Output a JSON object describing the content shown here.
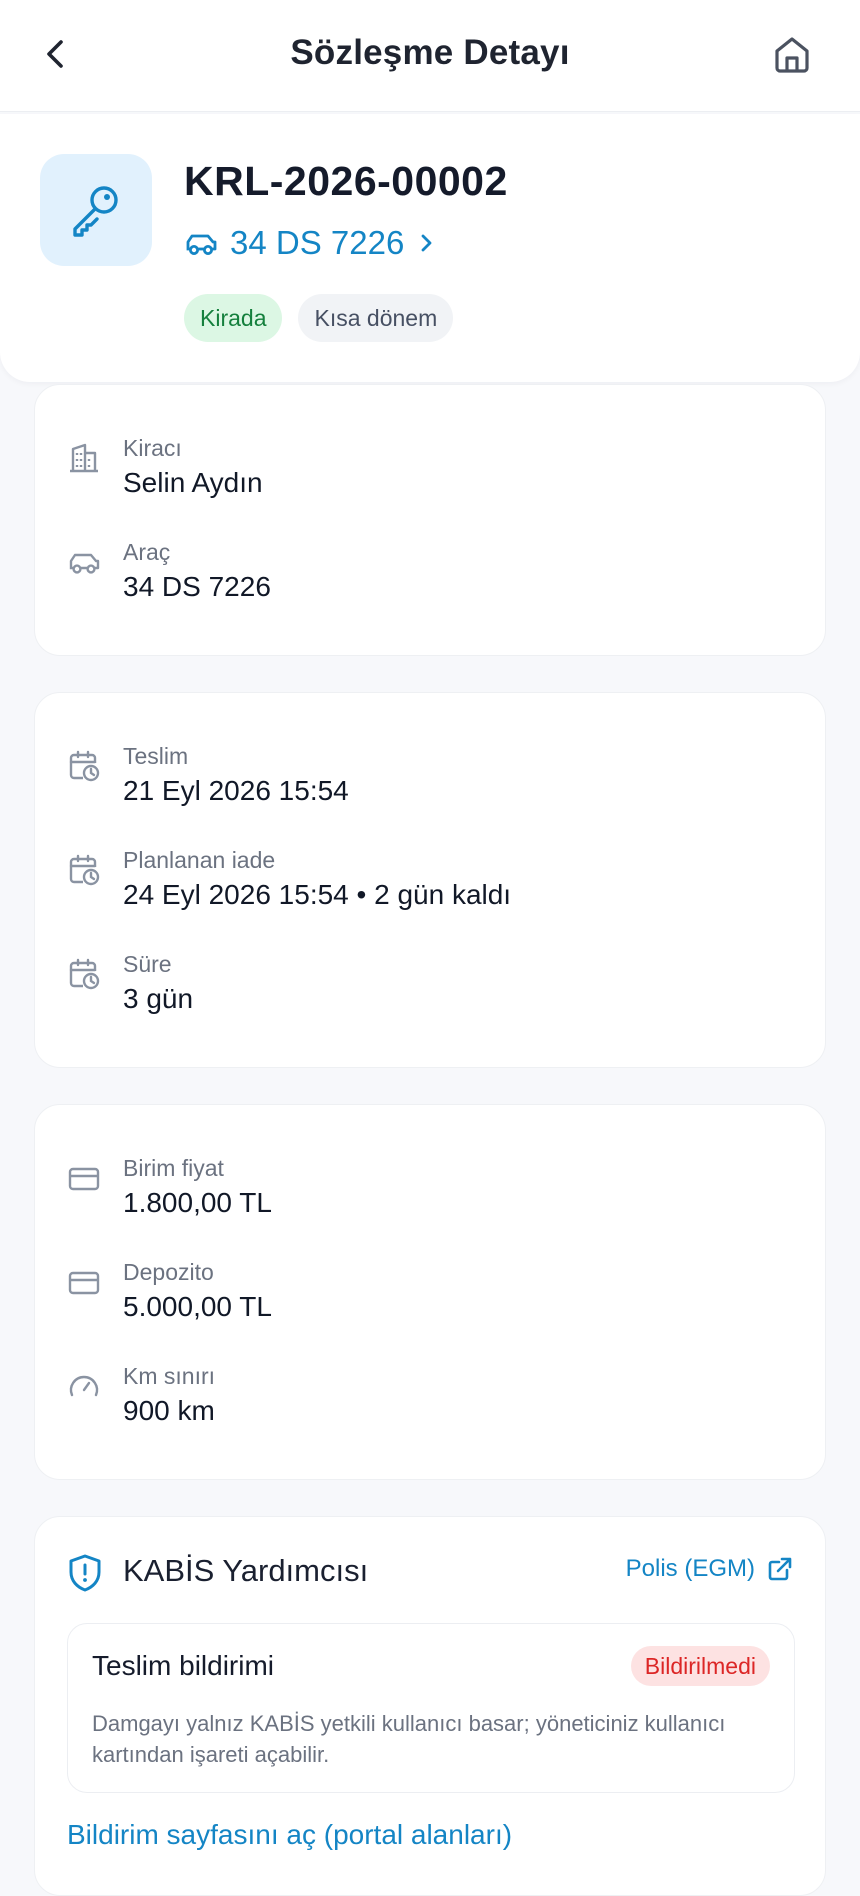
{
  "header": {
    "title": "Sözleşme Detayı"
  },
  "contract": {
    "number": "KRL-2026-00002",
    "plate": "34 DS 7226",
    "badges": [
      "Kirada",
      "Kısa dönem"
    ]
  },
  "party_card": {
    "rows": [
      {
        "label": "Kiracı",
        "value": "Selin Aydın",
        "icon": "building-icon"
      },
      {
        "label": "Araç",
        "value": "34 DS 7226",
        "icon": "car-icon"
      }
    ]
  },
  "dates_card": {
    "rows": [
      {
        "label": "Teslim",
        "value": "21 Eyl 2026 15:54",
        "icon": "calendar-clock-icon"
      },
      {
        "label": "Planlanan iade",
        "value": "24 Eyl 2026 15:54 • 2 gün kaldı",
        "icon": "calendar-clock-icon"
      },
      {
        "label": "Süre",
        "value": "3 gün",
        "icon": "calendar-clock-icon"
      }
    ]
  },
  "price_card": {
    "rows": [
      {
        "label": "Birim fiyat",
        "value": "1.800,00 TL",
        "icon": "credit-card-icon"
      },
      {
        "label": "Depozito",
        "value": "5.000,00 TL",
        "icon": "credit-card-icon"
      },
      {
        "label": "Km sınırı",
        "value": "900 km",
        "icon": "gauge-icon"
      }
    ]
  },
  "kabis": {
    "title": "KABİS Yardımcısı",
    "police_link": "Polis (EGM)",
    "notice": {
      "title": "Teslim bildirimi",
      "status": "Bildirilmedi",
      "description": "Damgayı yalnız KABİS yetkili kullanıcı basar; yöneticiniz kullanıcı kartından işareti açabilir."
    },
    "open_link": "Bildirim sayfasını aç (portal alanları)"
  },
  "colors": {
    "accent": "#1485c5",
    "success_bg": "#dcf7e4",
    "success_text": "#15803d",
    "danger_bg": "#fde2e2",
    "danger_text": "#dc2626"
  }
}
